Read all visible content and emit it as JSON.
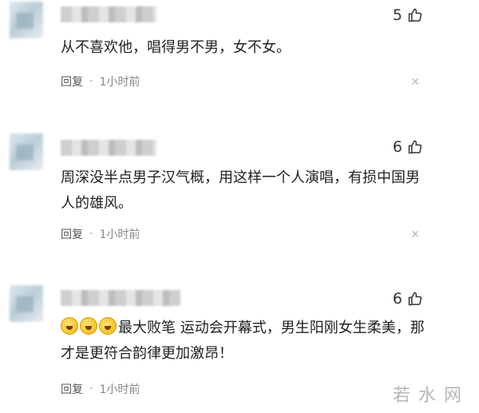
{
  "comments": [
    {
      "likes": "5",
      "text": "从不喜欢他，唱得男不男，女不女。",
      "reply_label": "回复",
      "separator": "·",
      "time": "1小时前"
    },
    {
      "likes": "6",
      "text": "周深没半点男子汉气概，用这样一个人演唱，有损中国男人的雄风。",
      "reply_label": "回复",
      "separator": "·",
      "time": "1小时前"
    },
    {
      "likes": "6",
      "emoji_icon": "laughing-emoji",
      "text": "最大败笔 运动会开幕式，男生阳刚女生柔美，那才是更符合韵律更加激昂！",
      "reply_label": "回复",
      "separator": "·",
      "time": "1小时前"
    }
  ],
  "watermark": "若水网",
  "colors": {
    "text": "#222222",
    "meta": "#555555",
    "muted": "#999999"
  }
}
